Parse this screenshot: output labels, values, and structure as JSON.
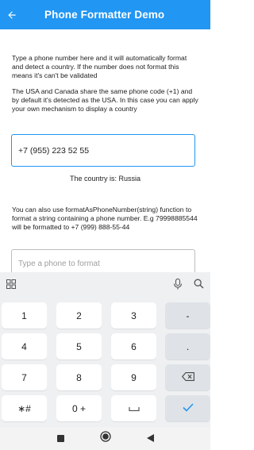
{
  "app": {
    "title": "Phone Formatter Demo",
    "accent_color": "#2196f3"
  },
  "content": {
    "intro": "Type a phone number here and it will automatically format and detect a country. If the number does not format this means it's can't be validated",
    "usa_canada_note": "The USA and Canada share the same phone code (+1) and by default it's detected as the USA. In this case you can apply your own mechanism to display a country",
    "phone_input_value": "+7 (955) 223 52 55",
    "country_label": "The country is: Russia",
    "format_note": "You can also use formatAsPhoneNumber(string) function to format a string containing a phone number. E.g 79998885544 will be formatted to +7 (999) 888-55-44",
    "format_input_placeholder": "Type a phone to format"
  },
  "keyboard": {
    "toolbar_icons": [
      "grid-icon",
      "mic-icon",
      "search-icon"
    ],
    "keys": [
      [
        "1",
        "2",
        "3",
        "-"
      ],
      [
        "4",
        "5",
        "6",
        "."
      ],
      [
        "7",
        "8",
        "9",
        "backspace"
      ],
      [
        "∗#",
        "0 +",
        "space",
        "enter"
      ]
    ]
  },
  "navbar": {
    "icons": [
      "recents-icon",
      "home-icon",
      "back-icon"
    ]
  }
}
